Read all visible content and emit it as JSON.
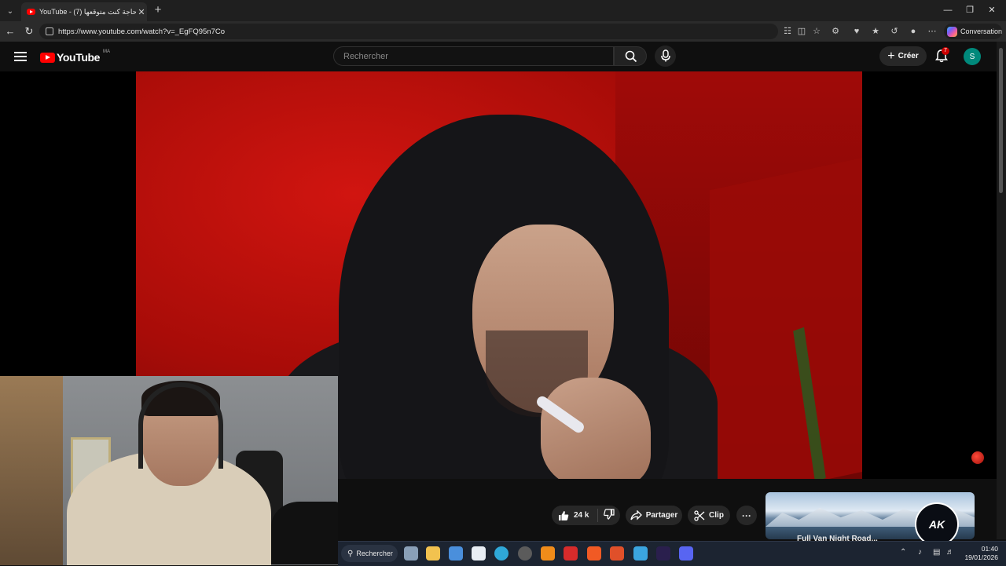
{
  "browser": {
    "tab_title": "YouTube - (7) آخر حاجة كنت متوقعها",
    "url": "https://www.youtube.com/watch?v=_EgFQ95n7Co",
    "copilot_label": "Conversation"
  },
  "header": {
    "logo_text": "YouTube",
    "country_code": "MA",
    "search_placeholder": "Rechercher",
    "create_label": "Créer",
    "notification_count": "7",
    "avatar_initial": "S"
  },
  "actions": {
    "like_count": "24 k",
    "share_label": "Partager",
    "clip_label": "Clip",
    "more_label": "···"
  },
  "suggested": {
    "title": "Full Van Night Road...",
    "channel_logo_text": "AK"
  },
  "taskbar": {
    "search_label": "Rechercher",
    "time": "01:40",
    "date": "19/01/2026"
  },
  "colors": {
    "youtube_red": "#ff0000",
    "avatar_bg": "#00897b",
    "badge_red": "#cc0000"
  }
}
